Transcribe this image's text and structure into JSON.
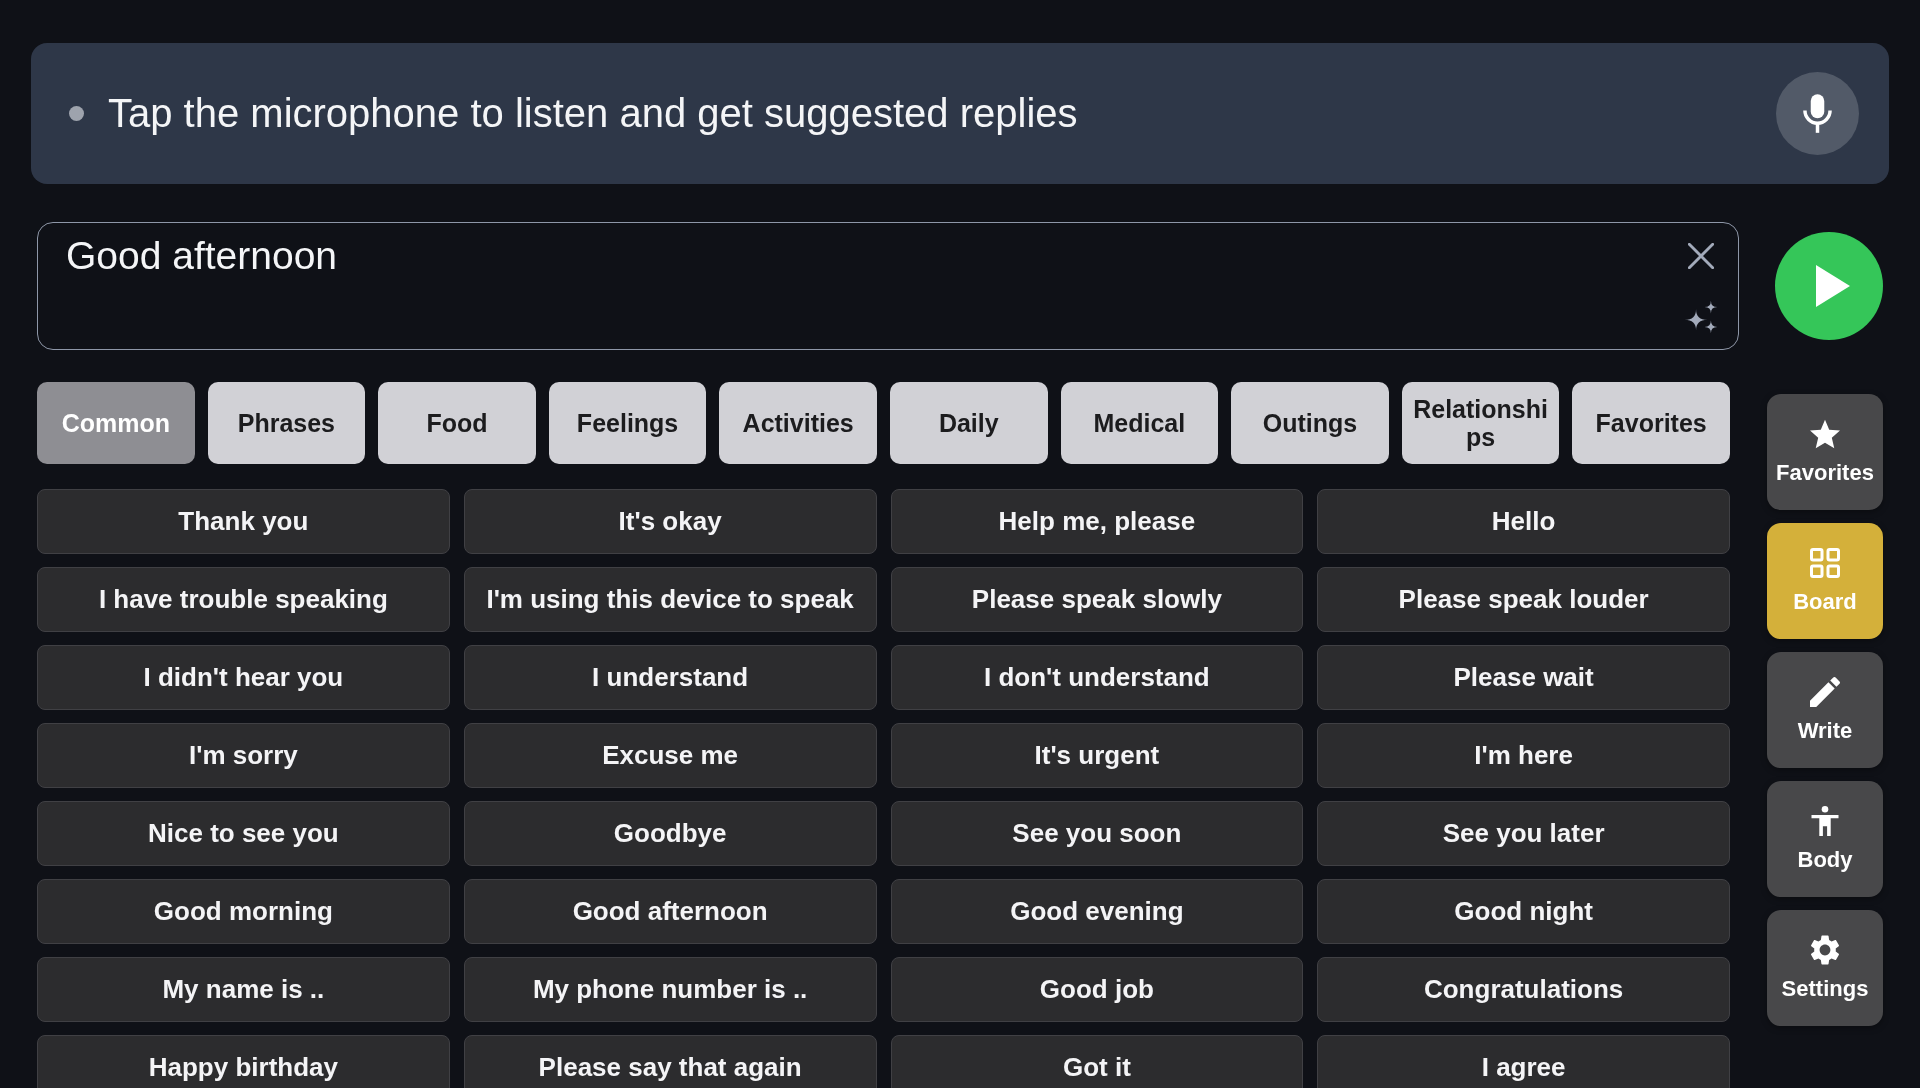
{
  "listen_banner": {
    "hint": "Tap the microphone to listen and get suggested replies"
  },
  "message_field": {
    "value": "Good afternoon"
  },
  "categories": [
    {
      "label": "Common",
      "selected": true
    },
    {
      "label": "Phrases",
      "selected": false
    },
    {
      "label": "Food",
      "selected": false
    },
    {
      "label": "Feelings",
      "selected": false
    },
    {
      "label": "Activities",
      "selected": false
    },
    {
      "label": "Daily",
      "selected": false
    },
    {
      "label": "Medical",
      "selected": false
    },
    {
      "label": "Outings",
      "selected": false
    },
    {
      "label": "Relationships",
      "selected": false
    },
    {
      "label": "Favorites",
      "selected": false
    }
  ],
  "phrases": [
    "Thank you",
    "It's okay",
    "Help me, please",
    "Hello",
    "I have trouble speaking",
    "I'm using this device to speak",
    "Please speak slowly",
    "Please speak louder",
    "I didn't hear you",
    "I understand",
    "I don't understand",
    "Please wait",
    "I'm sorry",
    "Excuse me",
    "It's urgent",
    "I'm here",
    "Nice to see you",
    "Goodbye",
    "See you soon",
    "See you later",
    "Good morning",
    "Good afternoon",
    "Good evening",
    "Good night",
    "My name is ..",
    "My phone number is ..",
    "Good job",
    "Congratulations",
    "Happy birthday",
    "Please say that again",
    "Got it",
    "I agree"
  ],
  "side_nav": [
    {
      "kind": "favorites",
      "label": "Favorites",
      "selected": false
    },
    {
      "kind": "board",
      "label": "Board",
      "selected": true
    },
    {
      "kind": "write",
      "label": "Write",
      "selected": false
    },
    {
      "kind": "body",
      "label": "Body",
      "selected": false
    },
    {
      "kind": "settings",
      "label": "Settings",
      "selected": false
    }
  ]
}
